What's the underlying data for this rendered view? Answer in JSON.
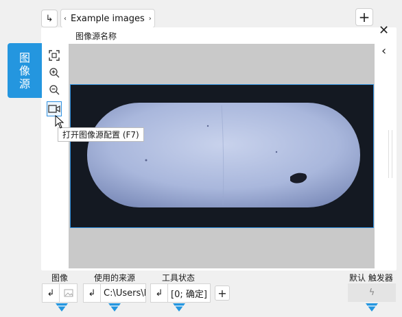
{
  "topbar": {
    "nav_glyph": "↳",
    "prev_glyph": "‹",
    "next_glyph": "›",
    "source_label": "Example images",
    "add_glyph": "+"
  },
  "panel": {
    "source_name_label": "图像源名称",
    "close_glyph": "✕",
    "collapse_glyph": "‹"
  },
  "side_tab": {
    "label_line1": "图",
    "label_line2": "像",
    "label_line3": "源"
  },
  "tools": [
    {
      "name": "fit-to-window-icon",
      "glyph": "⛶"
    },
    {
      "name": "zoom-in-icon",
      "glyph": "⊕"
    },
    {
      "name": "zoom-out-icon",
      "glyph": "⊖"
    },
    {
      "name": "camera-config-icon",
      "glyph": "▭"
    }
  ],
  "tooltip": {
    "text": "打开图像源配置 (F7)"
  },
  "bottom": {
    "image_label": "图像",
    "source_used_label": "使用的来源",
    "tool_state_label": "工具状态",
    "default_trigger_label": "默认 触发器",
    "arrow_glyph": "↲",
    "source_used_value": "C:\\Users\\P",
    "tool_state_value": "[0; 确定]",
    "add_glyph": "+",
    "trigger_glyph": "ϟ"
  },
  "colors": {
    "accent": "#2496df",
    "image_bg": "#151a22",
    "pill_fill": "#b7c3e0"
  }
}
